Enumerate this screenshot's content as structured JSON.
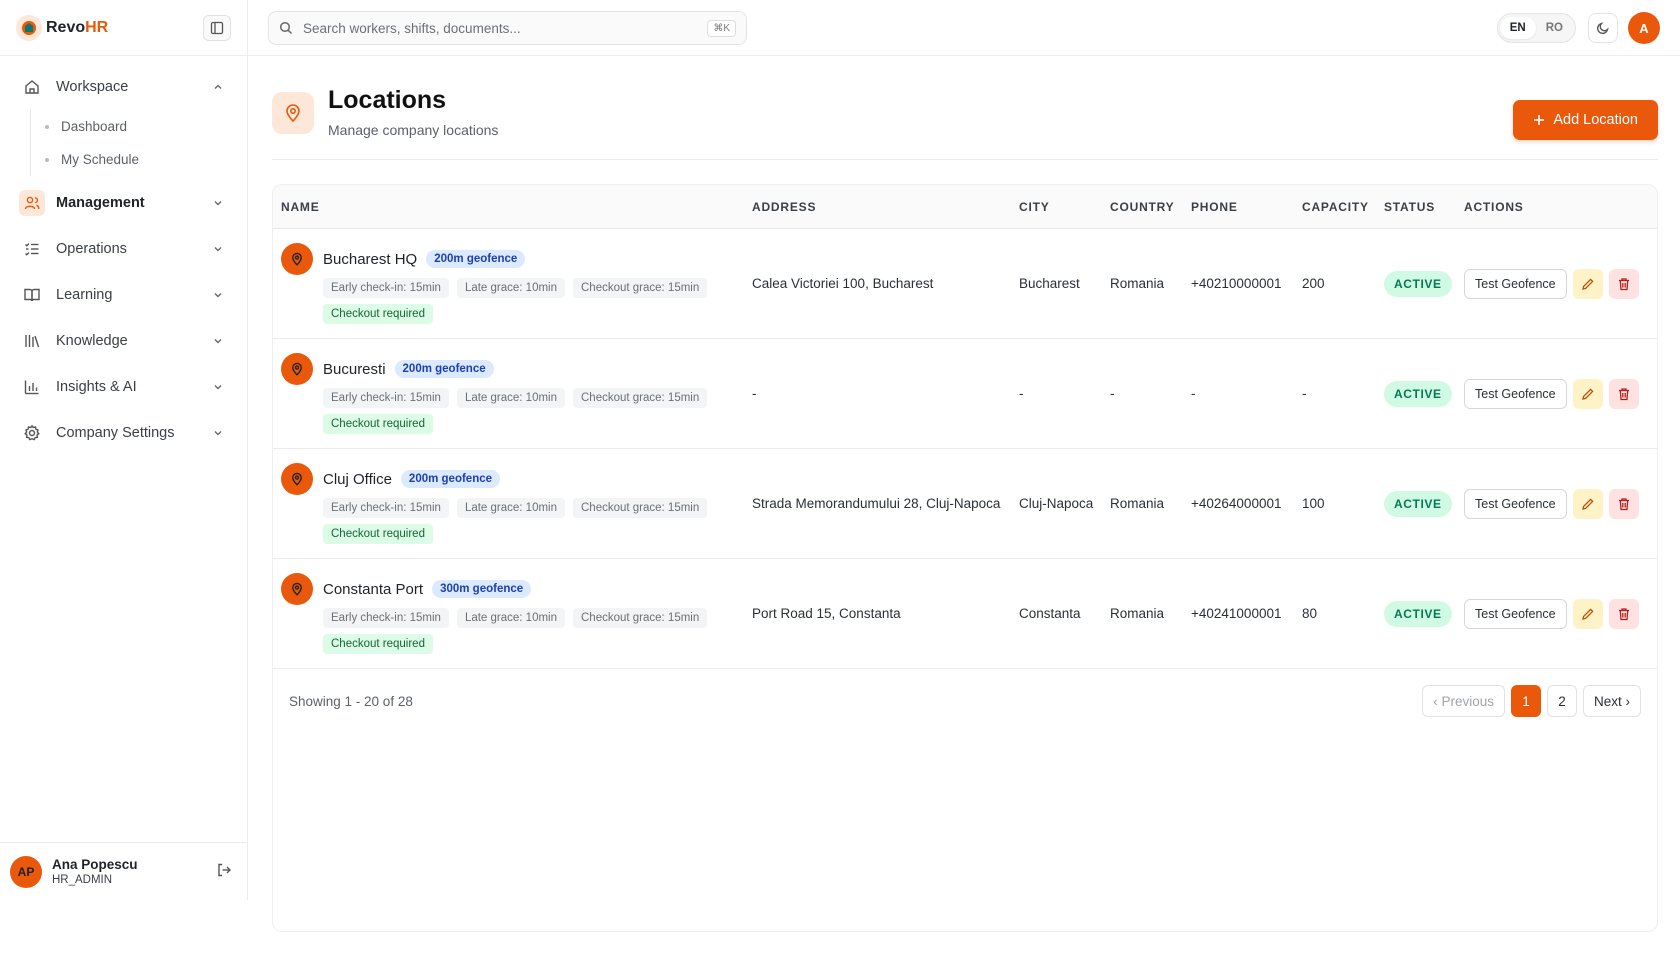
{
  "brand": {
    "name_part1": "Revo",
    "name_part2": "HR"
  },
  "sidebar": {
    "sections": [
      {
        "label": "Workspace",
        "icon": "home-icon",
        "expanded": true,
        "sub": [
          "Dashboard",
          "My Schedule"
        ]
      },
      {
        "label": "Management",
        "icon": "users-icon",
        "active": true
      },
      {
        "label": "Operations",
        "icon": "list-check-icon"
      },
      {
        "label": "Learning",
        "icon": "book-icon"
      },
      {
        "label": "Knowledge",
        "icon": "library-icon"
      },
      {
        "label": "Insights & AI",
        "icon": "bar-chart-icon"
      },
      {
        "label": "Company Settings",
        "icon": "gear-icon"
      }
    ]
  },
  "user": {
    "initials": "AP",
    "name": "Ana Popescu",
    "role": "HR_ADMIN"
  },
  "topbar": {
    "search_placeholder": "Search workers, shifts, documents...",
    "shortcut": "⌘K",
    "lang_en": "EN",
    "lang_ro": "RO",
    "avatar": "A"
  },
  "page": {
    "title": "Locations",
    "subtitle": "Manage company locations",
    "add_label": "Add Location"
  },
  "table": {
    "headers": [
      "NAME",
      "ADDRESS",
      "CITY",
      "COUNTRY",
      "PHONE",
      "CAPACITY",
      "STATUS",
      "ACTIONS"
    ],
    "rows": [
      {
        "name": "Bucharest HQ",
        "geofence": "200m geofence",
        "early": "Early check-in: 15min",
        "late": "Late grace: 10min",
        "checkout_grace": "Checkout grace: 15min",
        "checkout_req": "Checkout required",
        "address": "Calea Victoriei 100, Bucharest",
        "city": "Bucharest",
        "country": "Romania",
        "phone": "+40210000001",
        "capacity": "200",
        "status": "ACTIVE"
      },
      {
        "name": "Bucuresti",
        "geofence": "200m geofence",
        "early": "Early check-in: 15min",
        "late": "Late grace: 10min",
        "checkout_grace": "Checkout grace: 15min",
        "checkout_req": "Checkout required",
        "address": "-",
        "city": "-",
        "country": "-",
        "phone": "-",
        "capacity": "-",
        "status": "ACTIVE"
      },
      {
        "name": "Cluj Office",
        "geofence": "200m geofence",
        "early": "Early check-in: 15min",
        "late": "Late grace: 10min",
        "checkout_grace": "Checkout grace: 15min",
        "checkout_req": "Checkout required",
        "address": "Strada Memorandumului 28, Cluj-Napoca",
        "city": "Cluj-Napoca",
        "country": "Romania",
        "phone": "+40264000001",
        "capacity": "100",
        "status": "ACTIVE"
      },
      {
        "name": "Constanta Port",
        "geofence": "300m geofence",
        "early": "Early check-in: 15min",
        "late": "Late grace: 10min",
        "checkout_grace": "Checkout grace: 15min",
        "checkout_req": "Checkout required",
        "address": "Port Road 15, Constanta",
        "city": "Constanta",
        "country": "Romania",
        "phone": "+40241000001",
        "capacity": "80",
        "status": "ACTIVE"
      }
    ],
    "test_label": "Test Geofence"
  },
  "pagination": {
    "showing": "Showing 1 - 20 of 28",
    "prev": "‹ Previous",
    "pages": [
      "1",
      "2"
    ],
    "next": "Next ›"
  },
  "colors": {
    "accent": "#ea580c",
    "active_green": "#047857",
    "geofence_blue": "#1e40af"
  }
}
